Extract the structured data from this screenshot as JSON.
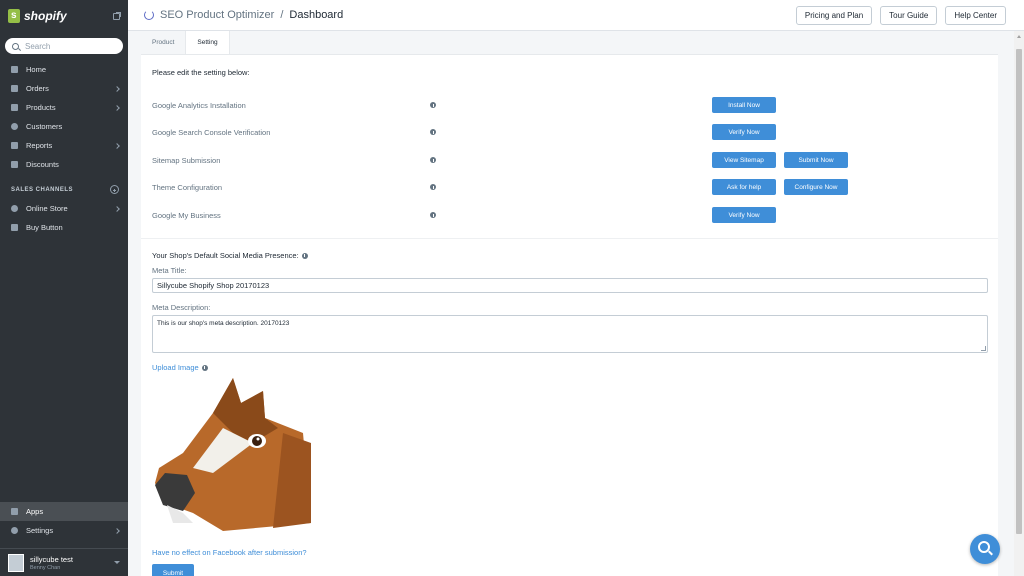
{
  "sidebar": {
    "brand": "shopify",
    "search_placeholder": "Search",
    "items": [
      {
        "label": "Home"
      },
      {
        "label": "Orders"
      },
      {
        "label": "Products"
      },
      {
        "label": "Customers"
      },
      {
        "label": "Reports"
      },
      {
        "label": "Discounts"
      }
    ],
    "sales_channels_title": "SALES CHANNELS",
    "channels": [
      {
        "label": "Online Store"
      },
      {
        "label": "Buy Button"
      }
    ],
    "bottom_items": [
      {
        "label": "Apps"
      },
      {
        "label": "Settings"
      }
    ],
    "user": {
      "name": "sillycube test",
      "sub": "Benny Chan"
    }
  },
  "header": {
    "app_name": "SEO Product Optimizer",
    "separator": "/",
    "page": "Dashboard",
    "buttons": [
      "Pricing and Plan",
      "Tour Guide",
      "Help Center"
    ]
  },
  "tabs": [
    "Product",
    "Setting"
  ],
  "settings": {
    "intro": "Please edit the setting below:",
    "rows": [
      {
        "label": "Google Analytics Installation",
        "buttons": [
          "Install Now"
        ]
      },
      {
        "label": "Google Search Console Verification",
        "buttons": [
          "Verify Now"
        ]
      },
      {
        "label": "Sitemap Submission",
        "buttons": [
          "View Sitemap",
          "Submit Now"
        ]
      },
      {
        "label": "Theme Configuration",
        "buttons": [
          "Ask for help",
          "Configure Now"
        ]
      },
      {
        "label": "Google My Business",
        "buttons": [
          "Verify Now"
        ]
      }
    ]
  },
  "social": {
    "title": "Your Shop's Default Social Media Presence:",
    "meta_title_label": "Meta Title:",
    "meta_title_value": "Sillycube Shopify Shop 20170123",
    "meta_desc_label": "Meta Description:",
    "meta_desc_value": "This is our shop's meta description. 20170123",
    "upload_label": "Upload Image",
    "fb_link": "Have no effect on Facebook after submission?",
    "submit": "Submit"
  },
  "colors": {
    "sidebar": "#2e3338",
    "accent": "#3f8ed8",
    "brand_green": "#95bf47"
  }
}
